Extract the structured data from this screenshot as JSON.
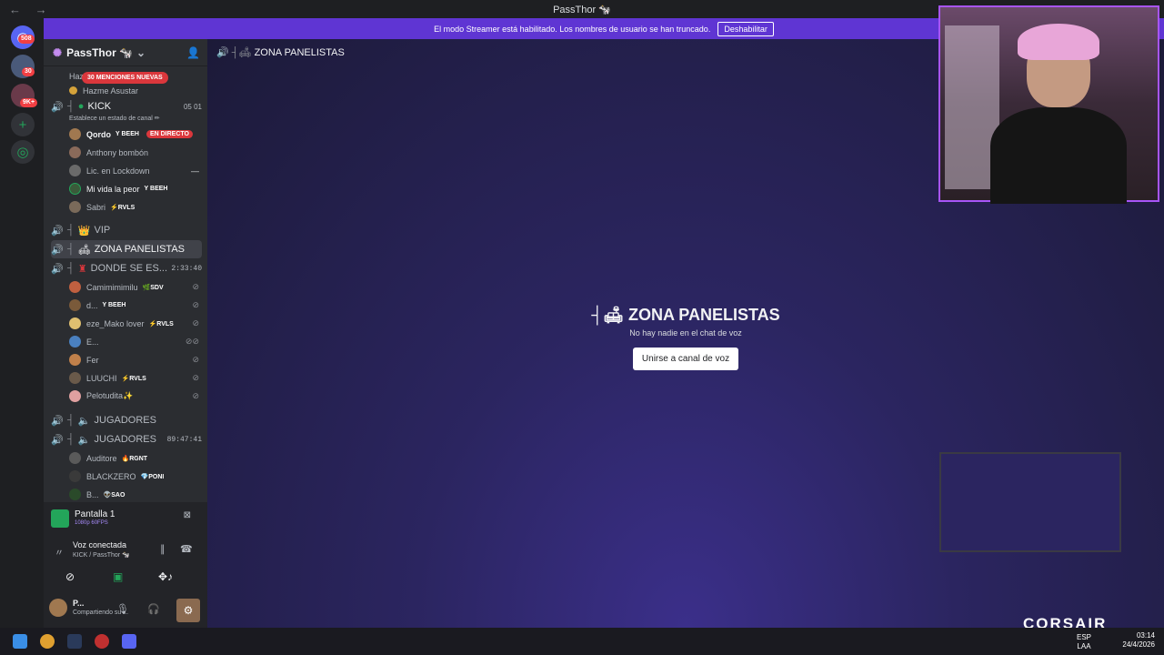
{
  "window": {
    "title": "PassThor 🐄"
  },
  "banner": {
    "text": "El modo Streamer está habilitado. Los nombres de usuario se han truncado.",
    "button": "Deshabilitar"
  },
  "servers": {
    "badge1": "508",
    "badge2": "30",
    "badge3": "9K+"
  },
  "guild": {
    "name": "PassThor 🐄"
  },
  "sidebar": {
    "top_channels": [
      {
        "label": "Hazme Reir"
      },
      {
        "label": "Hazme Asustar"
      }
    ],
    "mentions": "30 MENCIONES NUEVAS",
    "kick": {
      "label": "KICK",
      "counter": "05  01",
      "status": "Establece un estado de canal ✏"
    },
    "kick_users": [
      {
        "name": "Qordo",
        "tag": "Y BEEH",
        "live": "EN DIRECTO"
      },
      {
        "name": "Anthony bombón",
        "tag": ""
      },
      {
        "name": "Lic. en Lockdown",
        "tag": ""
      },
      {
        "name": "Mi vida la peor",
        "tag": "Y BEEH"
      },
      {
        "name": "Sabri",
        "tag": "⚡RVLS"
      }
    ],
    "vip": "VIP",
    "zona": "ZONA PANELISTAS",
    "donde": {
      "label": "DONDE SE ES...",
      "time": "2:33:40"
    },
    "donde_users": [
      {
        "name": "Camimimimilu",
        "tag": "🌿SDV"
      },
      {
        "name": "d...",
        "tag": "Y BEEH"
      },
      {
        "name": "eze_Mako lover",
        "tag": "⚡RVLS"
      },
      {
        "name": "E...",
        "tag": ""
      },
      {
        "name": "Fer",
        "tag": ""
      },
      {
        "name": "LUUCHI",
        "tag": "⚡RVLS"
      },
      {
        "name": "Pelotudita✨",
        "tag": ""
      }
    ],
    "jugadores1": "JUGADORES",
    "jugadores2": {
      "label": "JUGADORES",
      "time": "89:47:41"
    },
    "jug_users": [
      {
        "name": "Auditore",
        "tag": "🔥RGNT"
      },
      {
        "name": "BLACKZERO",
        "tag": "💎PONI"
      },
      {
        "name": "B...",
        "tag": "👽SAO"
      }
    ]
  },
  "screen": {
    "title": "Pantalla 1",
    "sub": "1080p 60FPS"
  },
  "voice": {
    "status": "Voz conectada",
    "channel": "KICK / PassThor 🐄"
  },
  "user": {
    "name": "P...",
    "status": "Compartiendo su ..."
  },
  "main": {
    "header": "ZONA PANELISTAS",
    "title": "ZONA PANELISTAS",
    "subtitle": "No hay nadie en el chat de voz",
    "join": "Unirse a canal de voz"
  },
  "taskbar": {
    "lang1": "ESP",
    "lang2": "LAA",
    "time": "03:14",
    "date": "24/4/2026"
  },
  "brand": "CORSAIR"
}
